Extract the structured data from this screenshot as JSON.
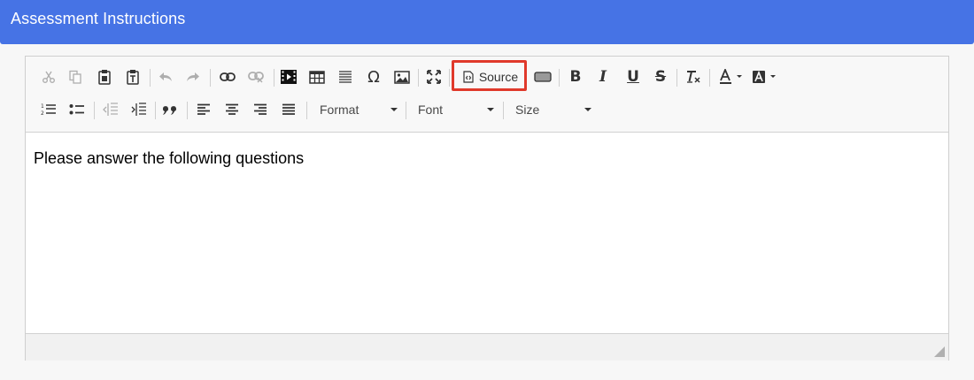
{
  "header": {
    "title": "Assessment Instructions",
    "color": "#4673e5"
  },
  "toolbar": {
    "row1": [
      "cut-icon",
      "copy-icon",
      "paste-icon",
      "paste-text-icon",
      "undo-icon",
      "redo-icon",
      "link-icon",
      "unlink-icon",
      "video-icon",
      "table-icon",
      "horizontal-line-icon",
      "special-char-icon",
      "image-icon",
      "maximize-icon",
      "source-icon",
      "preview-icon",
      "bold-icon",
      "italic-icon",
      "underline-icon",
      "strikethrough-icon",
      "remove-format-icon",
      "text-color-icon",
      "background-color-icon"
    ],
    "source_label": "Source",
    "highlight_color": "#e0392b",
    "row2": [
      "numbered-list-icon",
      "bulleted-list-icon",
      "decrease-indent-icon",
      "increase-indent-icon",
      "blockquote-icon",
      "align-left-icon",
      "align-center-icon",
      "align-right-icon",
      "justify-icon"
    ],
    "format_label": "Format",
    "font_label": "Font",
    "size_label": "Size",
    "bold_label": "B",
    "italic_label": "I",
    "underline_label": "U",
    "strike_label": "S"
  },
  "content": {
    "text": "Please answer the following questions"
  }
}
